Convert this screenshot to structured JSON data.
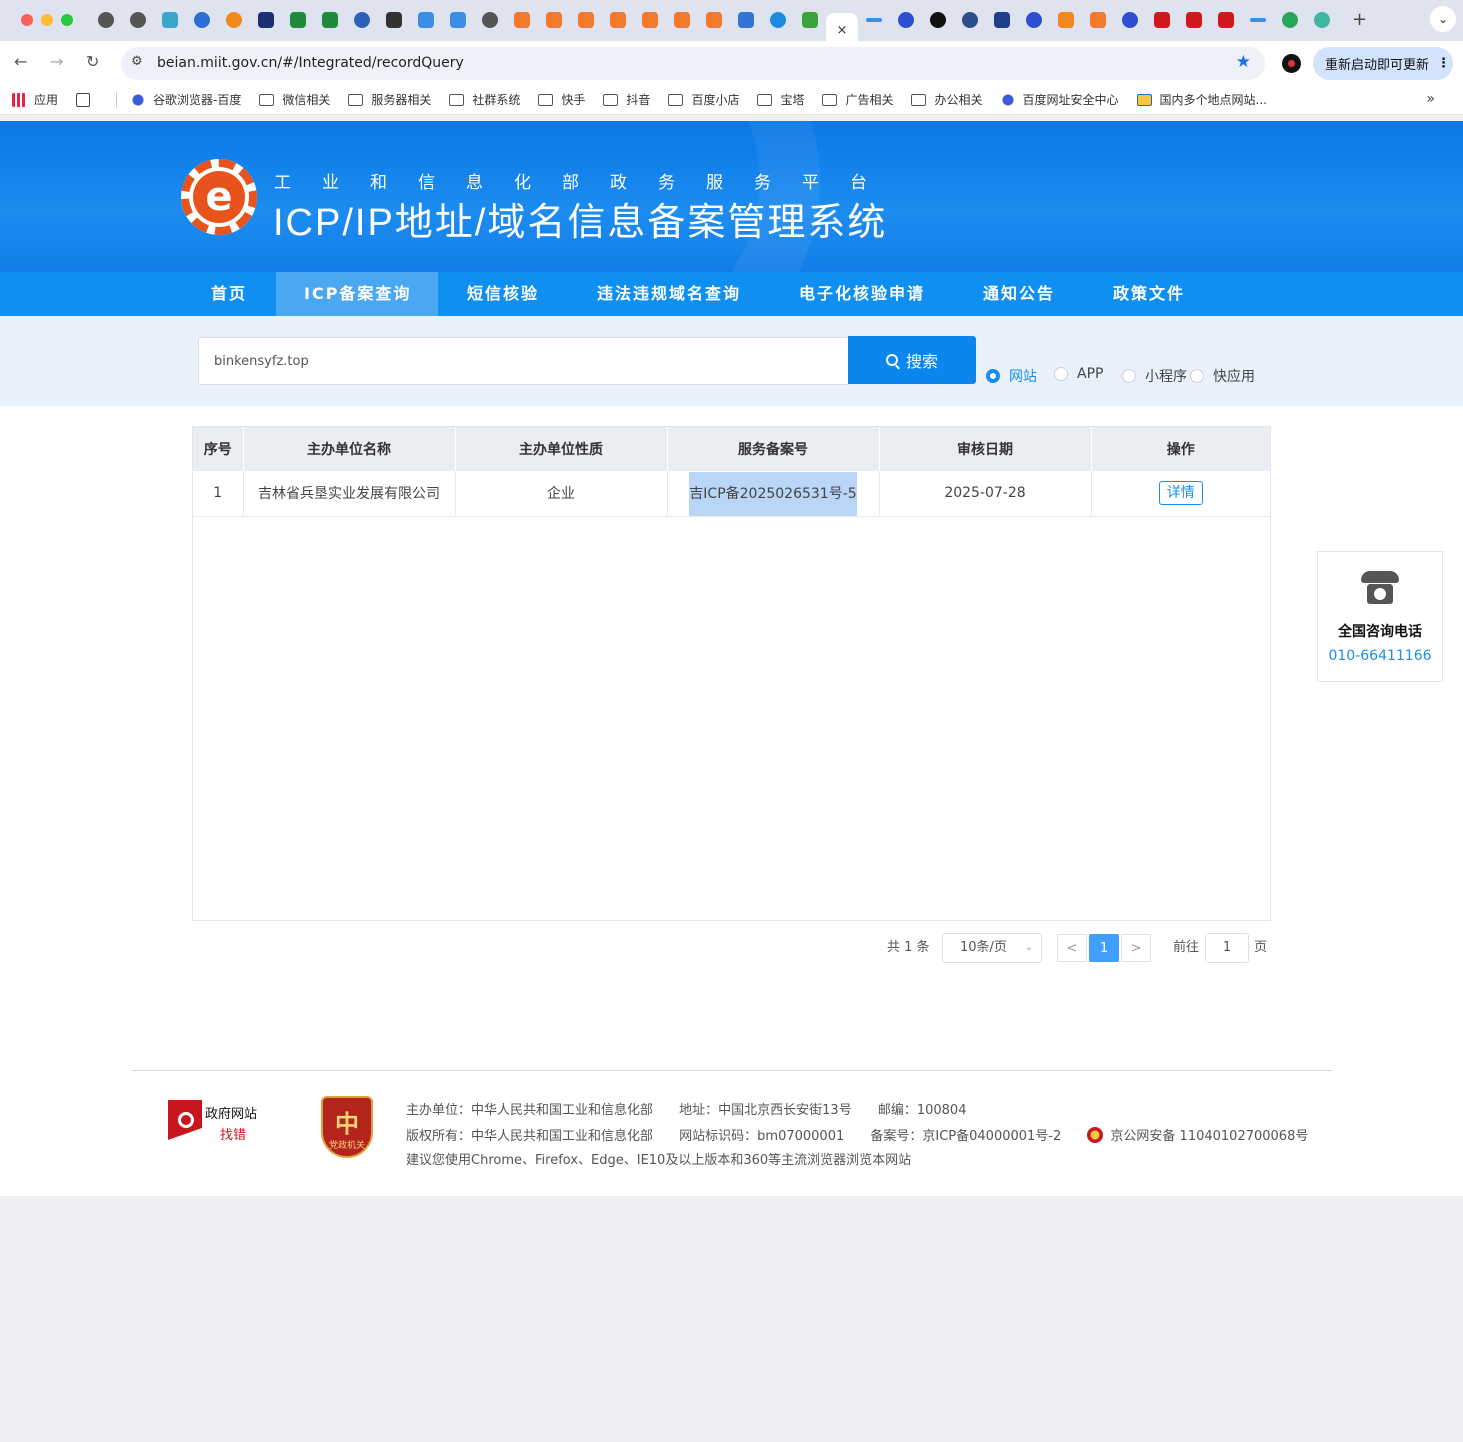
{
  "browser": {
    "tab_close": "×",
    "new_tab": "+",
    "tab_menu": "⌄",
    "url": "beian.miit.gov.cn/#/Integrated/recordQuery",
    "relaunch_label": "重新启动即可更新",
    "relaunch_more": "⋮",
    "back": "←",
    "forward": "→",
    "reload": "↻",
    "site_info": "⚙",
    "bookmark_star": "★",
    "bookmarks_more": "»",
    "bookmarks": [
      {
        "label": "应用",
        "icon": "grid"
      },
      {
        "label": "",
        "icon": "apps"
      },
      {
        "label": "谷歌浏览器-百度",
        "icon": "dot"
      },
      {
        "label": "微信相关",
        "icon": "folder"
      },
      {
        "label": "服务器相关",
        "icon": "folder"
      },
      {
        "label": "社群系统",
        "icon": "folder"
      },
      {
        "label": "快手",
        "icon": "folder"
      },
      {
        "label": "抖音",
        "icon": "folder"
      },
      {
        "label": "百度小店",
        "icon": "folder"
      },
      {
        "label": "宝塔",
        "icon": "folder"
      },
      {
        "label": "广告相关",
        "icon": "folder"
      },
      {
        "label": "办公相关",
        "icon": "folder"
      },
      {
        "label": "百度网址安全中心",
        "icon": "dot"
      },
      {
        "label": "国内多个地点网站...",
        "icon": "folder"
      }
    ]
  },
  "header": {
    "subtitle": "工业和信息化部政务服务平台",
    "title": "ICP/IP地址/域名信息备案管理系统",
    "logo_letter": "e"
  },
  "nav": [
    {
      "label": "首页"
    },
    {
      "label": "ICP备案查询"
    },
    {
      "label": "短信核验"
    },
    {
      "label": "违法违规域名查询"
    },
    {
      "label": "电子化核验申请"
    },
    {
      "label": "通知公告"
    },
    {
      "label": "政策文件"
    }
  ],
  "search": {
    "value": "binkensyfz.top",
    "button_label": "搜索",
    "types": [
      {
        "label": "网站",
        "selected": true
      },
      {
        "label": "APP",
        "selected": false
      },
      {
        "label": "小程序",
        "selected": false
      },
      {
        "label": "快应用",
        "selected": false
      }
    ]
  },
  "table": {
    "columns": [
      "序号",
      "主办单位名称",
      "主办单位性质",
      "服务备案号",
      "审核日期",
      "操作"
    ],
    "rows": [
      {
        "index": "1",
        "name": "吉林省兵垦实业发展有限公司",
        "nature": "企业",
        "record": "吉ICP备2025026531号-5",
        "date": "2025-07-28",
        "action": "详情"
      }
    ]
  },
  "pagination": {
    "total": "共 1 条",
    "page_size": "10条/页",
    "current": "1",
    "prev": "<",
    "next": ">",
    "goto_label": "前往",
    "goto_value": "1",
    "goto_suffix": "页"
  },
  "consult": {
    "title": "全国咨询电话",
    "phone": "010-66411166"
  },
  "footer": {
    "gov_line1": "政府网站",
    "gov_line2": "找错",
    "party_label": "党政机关",
    "party_glyph": "中",
    "row1": {
      "host": "主办单位：中华人民共和国工业和信息化部",
      "address": "地址：中国北京西长安街13号",
      "postcode": "邮编：100804"
    },
    "row2": {
      "copyright": "版权所有：中华人民共和国工业和信息化部",
      "site_code": "网站标识码：bm07000001",
      "icp": "备案号：京ICP备04000001号-2",
      "police": "京公网安备 11040102700068号"
    },
    "row3": "建议您使用Chrome、Firefox、Edge、IE10及以上版本和360等主流浏览器浏览本网站"
  }
}
